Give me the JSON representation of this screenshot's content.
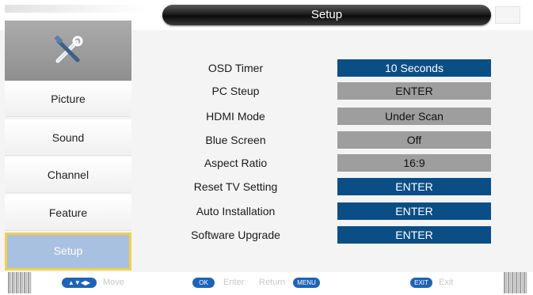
{
  "header": {
    "title": "Setup"
  },
  "sidebar": {
    "icon": "tools-icon",
    "items": [
      {
        "label": "Picture",
        "active": false
      },
      {
        "label": "Sound",
        "active": false
      },
      {
        "label": "Channel",
        "active": false
      },
      {
        "label": "Feature",
        "active": false
      },
      {
        "label": "Setup",
        "active": true
      }
    ]
  },
  "settings": [
    {
      "label": "OSD Timer",
      "value": "10 Seconds",
      "style": "blue"
    },
    {
      "label": "PC Steup",
      "value": "ENTER",
      "style": "gray"
    },
    {
      "label": "HDMI Mode",
      "value": "Under Scan",
      "style": "gray"
    },
    {
      "label": "Blue Screen",
      "value": "Off",
      "style": "gray"
    },
    {
      "label": "Aspect Ratio",
      "value": "16:9",
      "style": "gray"
    },
    {
      "label": "Reset TV Setting",
      "value": "ENTER",
      "style": "blue"
    },
    {
      "label": "Auto Installation",
      "value": "ENTER",
      "style": "blue"
    },
    {
      "label": "Software Upgrade",
      "value": "ENTER",
      "style": "blue"
    }
  ],
  "footer": {
    "nav_key": "▲▼◀▶",
    "nav_label": "Move",
    "ok_key": "OK",
    "ok_label": "Enter",
    "return_label": "Return",
    "menu_key": "MENU",
    "exit_key": "EXIT",
    "exit_label": "Exit"
  },
  "colors": {
    "value_blue": "#0b4e86",
    "value_gray": "#9e9e9e",
    "active_item_bg": "#a8c1e0",
    "active_item_border": "#f2d04a",
    "hint_key_blue": "#1f63b5"
  }
}
